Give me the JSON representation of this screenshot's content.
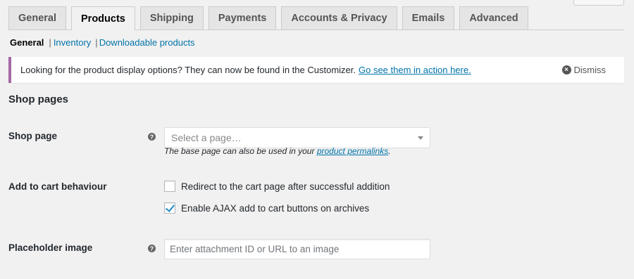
{
  "tabs": [
    {
      "label": "General",
      "active": false
    },
    {
      "label": "Products",
      "active": true
    },
    {
      "label": "Shipping",
      "active": false
    },
    {
      "label": "Payments",
      "active": false
    },
    {
      "label": "Accounts & Privacy",
      "active": false
    },
    {
      "label": "Emails",
      "active": false
    },
    {
      "label": "Advanced",
      "active": false
    }
  ],
  "subnav": {
    "current": "General",
    "sep": "|",
    "items": [
      "Inventory",
      "Downloadable products"
    ]
  },
  "notice": {
    "message": "Looking for the product display options? They can now be found in the Customizer.",
    "link": "Go see them in action here.",
    "dismiss": "Dismiss",
    "accent_color": "#a568a5"
  },
  "section": {
    "title": "Shop pages"
  },
  "shop_page": {
    "label": "Shop page",
    "help_icon": "help-icon",
    "placeholder": "Select a page…",
    "desc_prefix": "The base page can also be used in your",
    "desc_link": "product permalinks",
    "desc_suffix": "."
  },
  "add_to_cart": {
    "label": "Add to cart behaviour",
    "options": [
      {
        "label": "Redirect to the cart page after successful addition",
        "checked": false
      },
      {
        "label": "Enable AJAX add to cart buttons on archives",
        "checked": true
      }
    ]
  },
  "placeholder_image": {
    "label": "Placeholder image",
    "help_icon": "help-icon",
    "placeholder": "Enter attachment ID or URL to an image"
  },
  "colors": {
    "link": "#0073aa",
    "background": "#f1f1f1"
  }
}
